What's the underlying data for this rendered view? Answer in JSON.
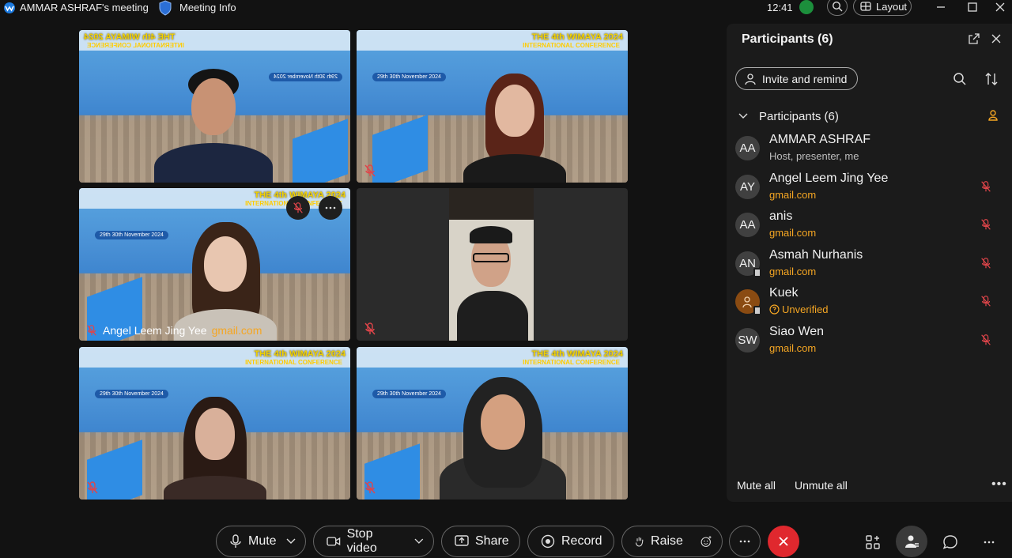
{
  "window": {
    "meeting_title": "AMMAR ASHRAF's meeting",
    "meeting_info": "Meeting Info",
    "clock": "12:41",
    "layout_label": "Layout"
  },
  "tiles": [
    {
      "banner_title": "THE 4th WIMAYA 2024",
      "banner_sub": "INTERNATIONAL CONFERENCE",
      "banner_date": "29th 30th November 2024",
      "muted": false
    },
    {
      "banner_title": "THE 4th WIMAYA 2024",
      "banner_sub": "INTERNATIONAL CONFERENCE",
      "banner_date": "29th 30th November 2024",
      "muted": true
    },
    {
      "banner_title": "THE 4th WIMAYA 2024",
      "banner_sub": "INTERNATIONAL CONFERENCE",
      "banner_date": "29th 30th November 2024",
      "muted": true,
      "name": "Angel Leem Jing Yee",
      "domain": "gmail.com"
    },
    {
      "muted": true
    },
    {
      "banner_title": "THE 4th WIMAYA 2024",
      "banner_sub": "INTERNATIONAL CONFERENCE",
      "banner_date": "29th 30th November 2024",
      "muted": true
    },
    {
      "banner_title": "THE 4th WIMAYA 2024",
      "banner_sub": "INTERNATIONAL CONFERENCE",
      "banner_date": "29th 30th November 2024",
      "muted": true
    }
  ],
  "panel": {
    "title": "Participants (6)",
    "invite_label": "Invite and remind",
    "section_label": "Participants (6)",
    "participants": [
      {
        "initials": "AA",
        "name": "AMMAR ASHRAF",
        "sub": "Host, presenter, me",
        "sub_type": "role",
        "muted": false
      },
      {
        "initials": "AY",
        "name": "Angel Leem Jing Yee",
        "sub": "gmail.com",
        "sub_type": "email",
        "muted": true
      },
      {
        "initials": "AA",
        "name": "anis",
        "sub": "gmail.com",
        "sub_type": "email",
        "muted": true
      },
      {
        "initials": "AN",
        "name": "Asmah Nurhanis",
        "sub": "gmail.com",
        "sub_type": "email",
        "muted": true
      },
      {
        "initials": "",
        "name": "Kuek",
        "sub": "Unverified",
        "sub_type": "unverified",
        "muted": true
      },
      {
        "initials": "SW",
        "name": "Siao Wen",
        "sub": "gmail.com",
        "sub_type": "email",
        "muted": true
      }
    ],
    "mute_all": "Mute all",
    "unmute_all": "Unmute all"
  },
  "controls": {
    "mute": "Mute",
    "stop_video": "Stop video",
    "share": "Share",
    "record": "Record",
    "raise": "Raise"
  },
  "colors": {
    "accent_email": "#f5a623",
    "end_call": "#e0282e",
    "mic_off": "#e0454a",
    "panel_bg": "#1b1b1b"
  }
}
